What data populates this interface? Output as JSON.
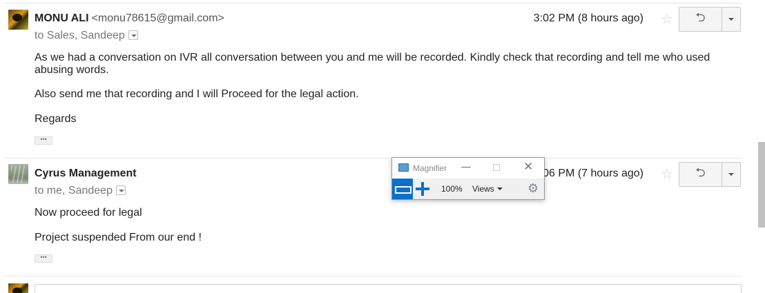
{
  "messages": [
    {
      "sender": "MONU ALI",
      "email": "<monu78615@gmail.com>",
      "to": "to Sales, Sandeep",
      "time": "3:02 PM (8 hours ago)",
      "body": [
        "As we had a conversation on IVR all conversation between you and me will be recorded. Kindly check that recording and tell me who used abusing words.",
        "Also send me that recording and I will Proceed for the legal action.",
        "Regards"
      ],
      "ellipsis": "•••"
    },
    {
      "sender": "Cyrus Management",
      "to": "to me, Sandeep",
      "time": "4:06 PM (7 hours ago)",
      "body": [
        "Now proceed for legal",
        "Project suspended From our end !"
      ],
      "ellipsis": "•••"
    }
  ],
  "icons": {
    "star": "☆",
    "reply": "⮌"
  },
  "magnifier": {
    "title": "Magnifier",
    "minimize": "—",
    "close": "✕",
    "zoom": "100%",
    "views": "Views",
    "gear": "⚙",
    "accent": "#0c6fcd"
  }
}
